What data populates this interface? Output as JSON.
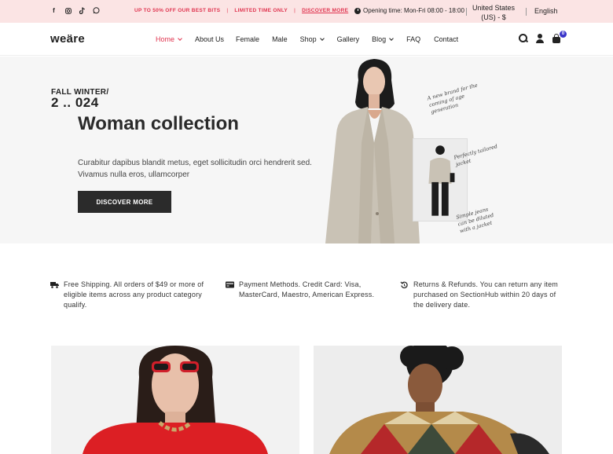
{
  "topbar": {
    "social": [
      "facebook-icon",
      "instagram-icon",
      "tiktok-icon",
      "whatsapp-icon"
    ],
    "promo_1": "UP TO 50% OFF OUR BEST BITS",
    "promo_sep": "|",
    "promo_2": "LIMITED TIME ONLY",
    "promo_link": "DISCOVER MORE",
    "opening": "Opening time: Mon-Fri 08:00 - 18:00",
    "currency": "United States (US) - $",
    "language": "English"
  },
  "nav": {
    "logo": "weäre",
    "items": [
      {
        "label": "Home",
        "dropdown": true,
        "active": true
      },
      {
        "label": "About Us",
        "dropdown": false
      },
      {
        "label": "Female",
        "dropdown": false
      },
      {
        "label": "Male",
        "dropdown": false
      },
      {
        "label": "Shop",
        "dropdown": true
      },
      {
        "label": "Gallery",
        "dropdown": false
      },
      {
        "label": "Blog",
        "dropdown": true
      },
      {
        "label": "FAQ",
        "dropdown": false
      },
      {
        "label": "Contact",
        "dropdown": false
      }
    ],
    "cart_count": "0"
  },
  "hero": {
    "season": "FALL WINTER/",
    "year": "2 .. 024",
    "title": "Woman collection",
    "subtitle": "Curabitur dapibus blandit metus, eget sollicitudin orci hendrerit sed. Vivamus nulla eros, ullamcorper",
    "button": "DISCOVER MORE",
    "note_1": "A new brand for the coming of age generation",
    "note_2": "Perfectly tailored jacket",
    "note_3": "Simple jeans can be diluted with a jacket"
  },
  "features": [
    {
      "icon": "truck-icon",
      "text": "Free Shipping. All orders of $49 or more of eligible items across any product category qualify."
    },
    {
      "icon": "credit-card-icon",
      "text": "Payment Methods. Credit Card: Visa, MasterCard, Maestro, American Express."
    },
    {
      "icon": "return-icon",
      "text": "Returns & Refunds. You can return any item purchased on SectionHub within 20 days of the delivery date."
    }
  ],
  "colors": {
    "accent": "#e0344f",
    "topbar_bg": "#fbe4e4",
    "badge": "#3a35c9",
    "button_bg": "#2b2b2b"
  }
}
